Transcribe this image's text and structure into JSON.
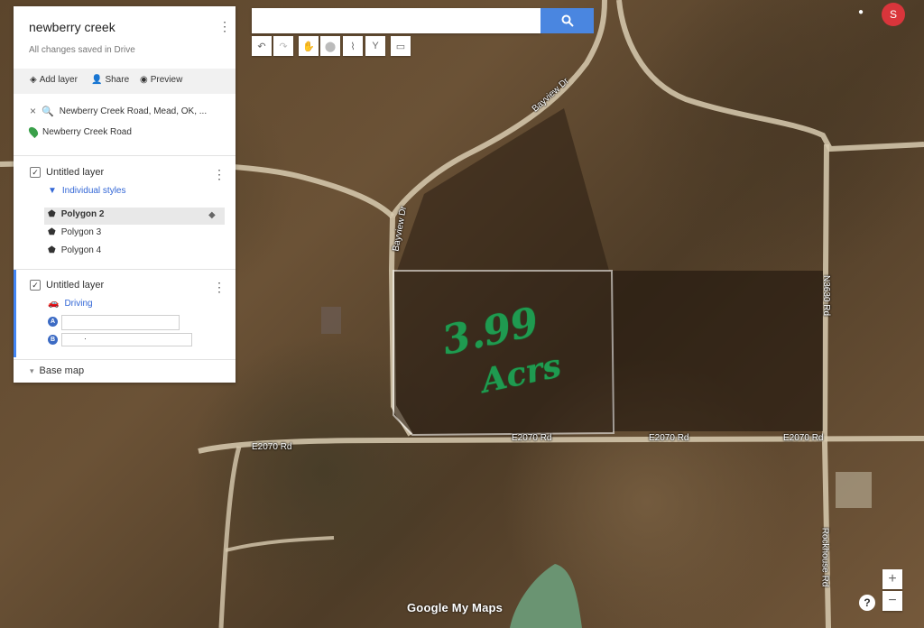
{
  "map": {
    "title": "newberry creek",
    "save_status": "All changes saved in Drive",
    "menu_icon": "kebab-icon"
  },
  "toolbar": {
    "add_layer": "Add layer",
    "share": "Share",
    "preview": "Preview"
  },
  "search_result": {
    "query": "Newberry Creek Road, Mead, OK, ...",
    "place": "Newberry Creek Road"
  },
  "layers": [
    {
      "name": "Untitled layer",
      "style": "Individual styles",
      "checked": true,
      "items": [
        "Polygon 2",
        "Polygon 3",
        "Polygon 4"
      ]
    },
    {
      "name": "Untitled layer",
      "style": "Driving",
      "checked": true,
      "waypoints": [
        {
          "label": "A",
          "value": ""
        },
        {
          "label": "B",
          "value": "·"
        }
      ]
    }
  ],
  "base_map": "Base map",
  "search": {
    "placeholder": ""
  },
  "user": {
    "initial": "S"
  },
  "annotation": {
    "line1": "3.99",
    "line2": "Acrs"
  },
  "road_labels": [
    "Bayview Dr",
    "Bayview Dr",
    "N3630 Rd",
    "E2070 Rd",
    "E2070 Rd",
    "E2070 Rd",
    "E2070 Rd",
    "Rockhouse Rd"
  ],
  "zoom": {
    "in": "+",
    "out": "−"
  },
  "help": "?",
  "logo": "Google My Maps",
  "colors": {
    "accent": "#4285f4",
    "avatar": "#d9353b",
    "search_button": "#4a86e0",
    "handwriting": "#1f9a50"
  }
}
